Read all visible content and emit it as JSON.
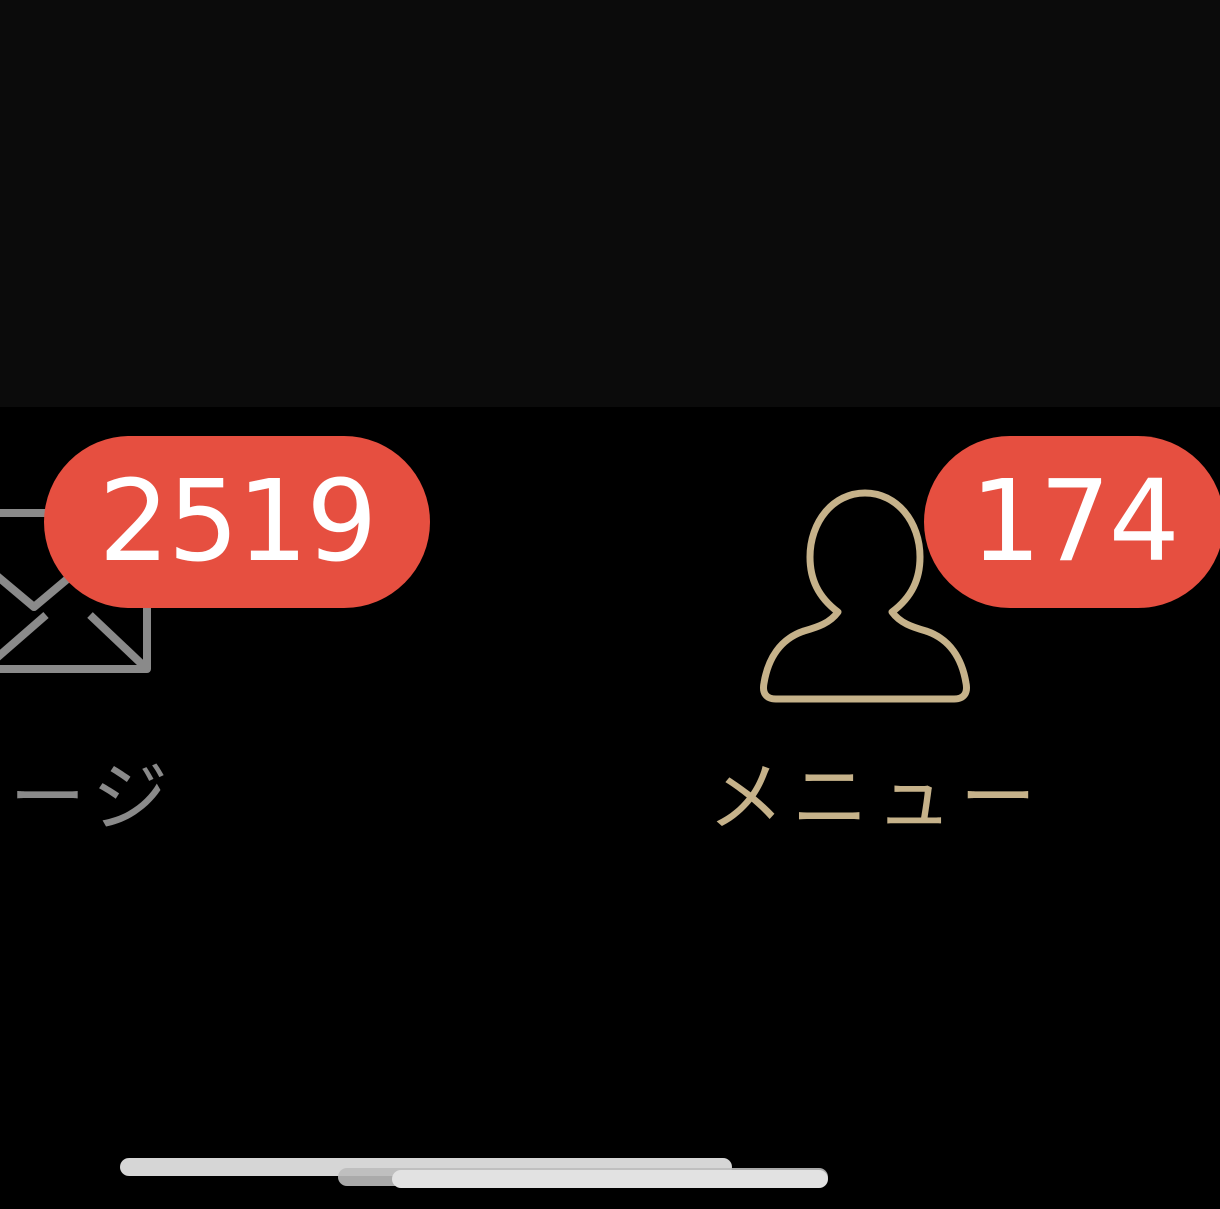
{
  "tab_bar": {
    "messages": {
      "label": "セージ",
      "badge_count": "2519",
      "icon": "envelope-icon",
      "color": "#8a8a8a"
    },
    "menu": {
      "label": "メニュー",
      "badge_count": "174",
      "icon": "person-icon",
      "color": "#c6b28a",
      "selected": true
    },
    "badge_color": "#e64f40"
  },
  "colors": {
    "content_background": "#0b0b0b",
    "tab_bar_background": "#000000",
    "home_indicator": "#d6d6d6"
  }
}
